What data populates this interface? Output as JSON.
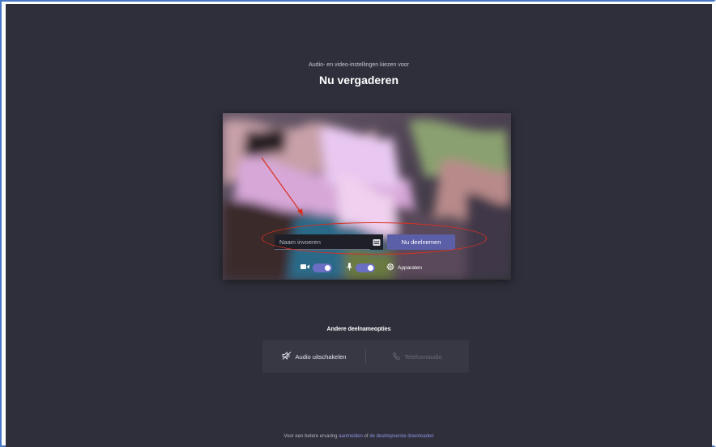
{
  "header": {
    "subtitle": "Audio- en video-instellingen kiezen voor",
    "title": "Nu vergaderen"
  },
  "prejoin": {
    "name_placeholder": "Naam invoeren",
    "join_label": "Nu deelnemen",
    "keyboard_icon": "keyboard-icon",
    "camera": {
      "icon": "camera-icon",
      "enabled": true
    },
    "microphone": {
      "icon": "microphone-icon",
      "enabled": true
    },
    "devices_label": "Apparaten",
    "devices_icon": "gear-icon"
  },
  "other_options": {
    "title": "Andere deelnameopties",
    "audio_off_label": "Audio uitschakelen",
    "audio_off_icon": "speaker-off-icon",
    "phone_label": "Telefoonaudio",
    "phone_icon": "phone-icon"
  },
  "footer": {
    "prefix": "Voor een betere ervaring ",
    "link_signin": "aanmelden",
    "middle": " of ",
    "link_download": "de desktopversie downloaden"
  },
  "annotation": {
    "color": "#d83020"
  },
  "colors": {
    "background": "#2f2f3b",
    "accent": "#5b5fa8",
    "toggle": "#6b6fc4"
  }
}
